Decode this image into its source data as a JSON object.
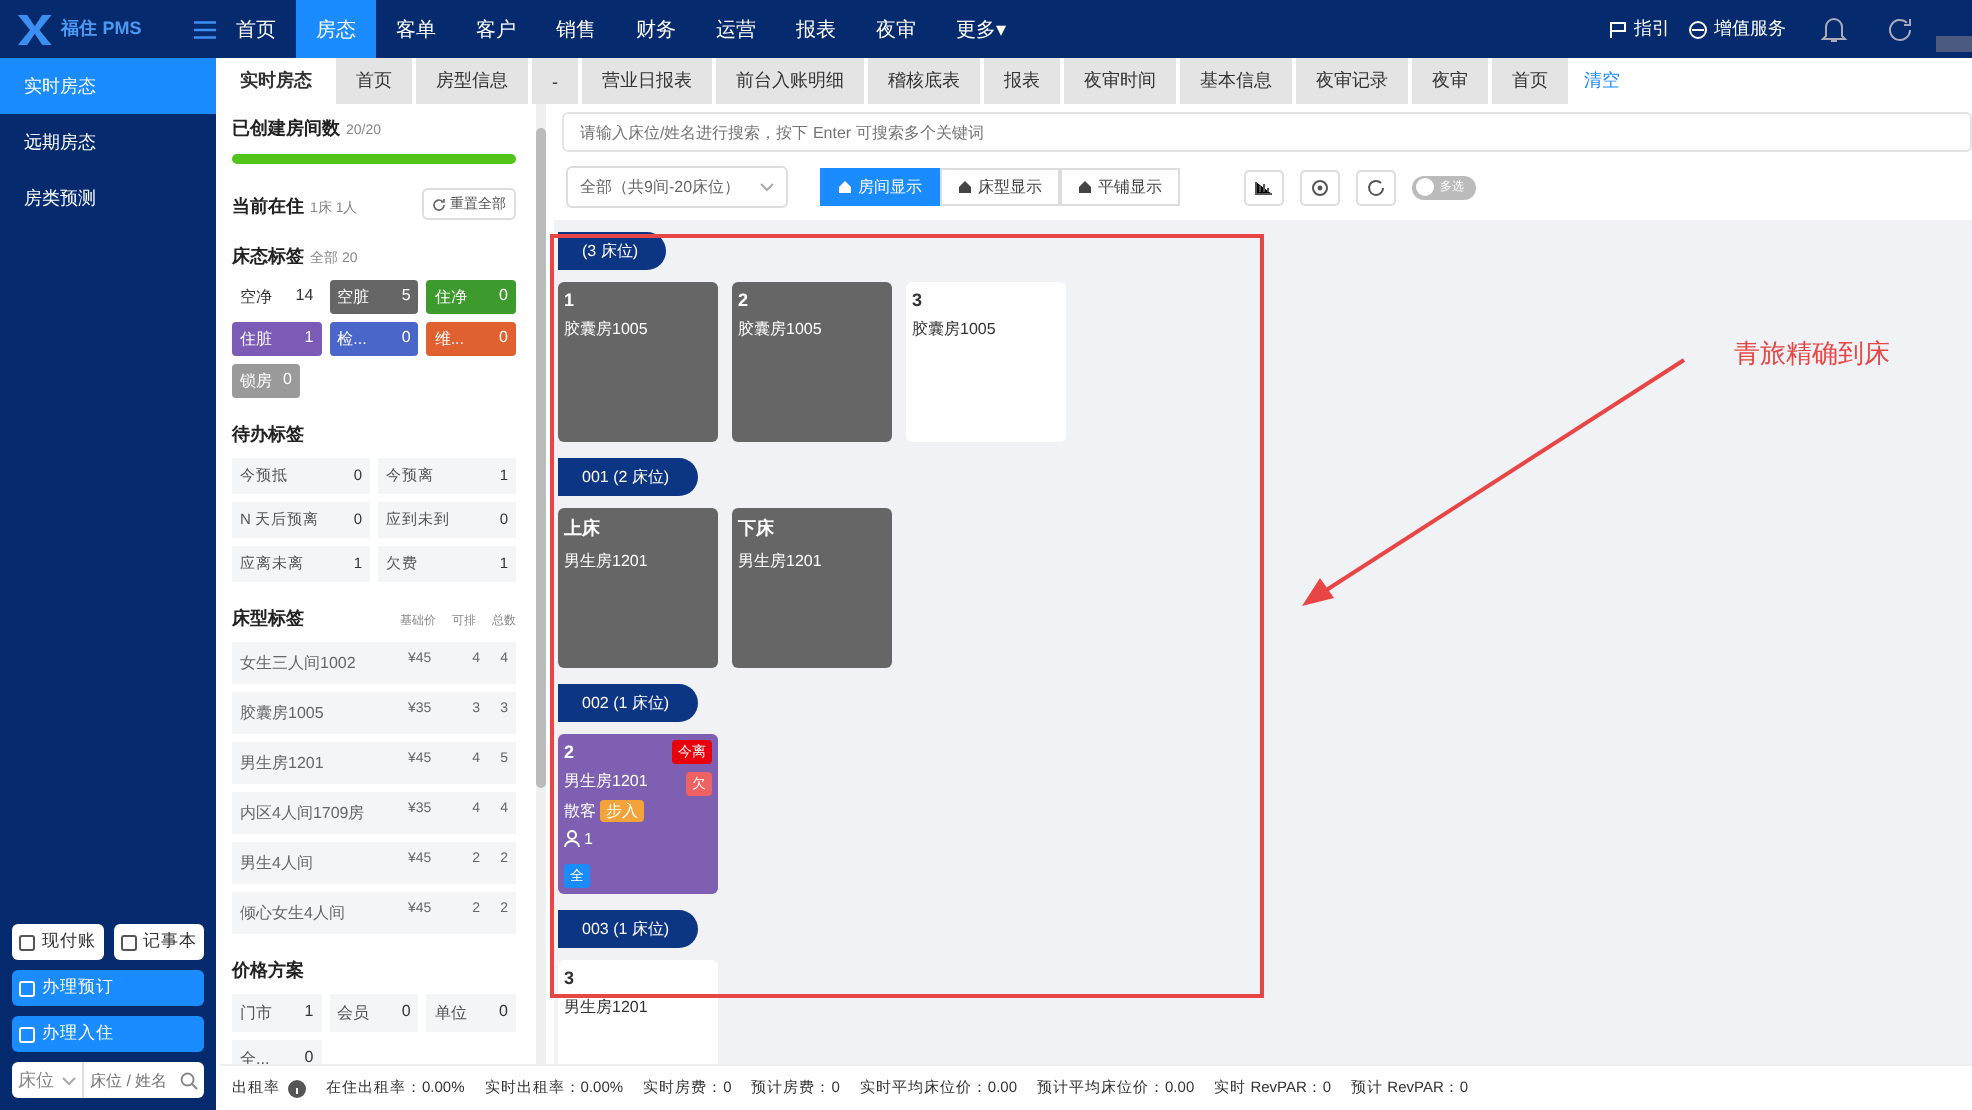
{
  "brand": "福住 PMS",
  "nav": [
    {
      "label": "首页",
      "selected": false
    },
    {
      "label": "房态",
      "selected": true
    },
    {
      "label": "客单",
      "selected": false
    },
    {
      "label": "客户",
      "selected": false
    },
    {
      "label": "销售",
      "selected": false
    },
    {
      "label": "财务",
      "selected": false
    },
    {
      "label": "运营",
      "selected": false
    },
    {
      "label": "报表",
      "selected": false
    },
    {
      "label": "夜审",
      "selected": false
    },
    {
      "label": "更多▾",
      "selected": false
    }
  ],
  "nav_right": {
    "guide": "指引",
    "services": "增值服务"
  },
  "sidebar": {
    "items": [
      {
        "label": "实时房态",
        "selected": true
      },
      {
        "label": "远期房态",
        "selected": false
      },
      {
        "label": "房类预测",
        "selected": false
      }
    ],
    "buttons": [
      {
        "label": "现付账",
        "kind": "outline"
      },
      {
        "label": "记事本",
        "kind": "outline"
      },
      {
        "label": "办理预订",
        "kind": "primary"
      },
      {
        "label": "办理入住",
        "kind": "primary"
      }
    ],
    "search": {
      "select": "床位",
      "placeholder": "床位 / 姓名"
    }
  },
  "tabs": [
    {
      "label": "实时房态",
      "selected": true
    },
    {
      "label": "首页",
      "selected": false
    },
    {
      "label": "房型信息",
      "selected": false
    },
    {
      "label": "-",
      "selected": false
    },
    {
      "label": "营业日报表",
      "selected": false
    },
    {
      "label": "前台入账明细",
      "selected": false
    },
    {
      "label": "稽核底表",
      "selected": false
    },
    {
      "label": "报表",
      "selected": false
    },
    {
      "label": "夜审时间",
      "selected": false
    },
    {
      "label": "基本信息",
      "selected": false
    },
    {
      "label": "夜审记录",
      "selected": false
    },
    {
      "label": "夜审",
      "selected": false
    },
    {
      "label": "首页",
      "selected": false
    }
  ],
  "tabs_clear": "清空",
  "panel": {
    "created": {
      "title": "已创建房间数",
      "count": "20/20",
      "level": 1
    },
    "current": {
      "title": "当前在住",
      "count": "1床 1人",
      "reset": "重置全部"
    },
    "status_tags": {
      "title": "床态标签",
      "all": "全部 20",
      "items": [
        {
          "label": "空净",
          "count": "14",
          "color": "#ffffff"
        },
        {
          "label": "空脏",
          "count": "5",
          "color": "#666666"
        },
        {
          "label": "住净",
          "count": "0",
          "color": "#3d9a2c"
        },
        {
          "label": "住脏",
          "count": "1",
          "color": "#7c5bb6"
        },
        {
          "label": "检...",
          "count": "0",
          "color": "#4a66c8"
        },
        {
          "label": "维...",
          "count": "0",
          "color": "#e0602f"
        },
        {
          "label": "锁房",
          "count": "0",
          "color": "#9a9a9a"
        }
      ]
    },
    "todo": {
      "title": "待办标签",
      "items": [
        {
          "label": "今预抵",
          "count": "0"
        },
        {
          "label": "今预离",
          "count": "1"
        },
        {
          "label": "N 天后预离",
          "count": "0"
        },
        {
          "label": "应到未到",
          "count": "0"
        },
        {
          "label": "应离未离",
          "count": "1"
        },
        {
          "label": "欠费",
          "count": "1"
        }
      ]
    },
    "bed_types": {
      "title": "床型标签",
      "columns": [
        "基础价",
        "可排",
        "总数"
      ],
      "rows": [
        {
          "name": "女生三人间1002",
          "price": "¥45",
          "available": "4",
          "total": "4"
        },
        {
          "name": "胶囊房1005",
          "price": "¥35",
          "available": "3",
          "total": "3"
        },
        {
          "name": "男生房1201",
          "price": "¥45",
          "available": "4",
          "total": "5"
        },
        {
          "name": "内区4人间1709房",
          "price": "¥35",
          "available": "4",
          "total": "4"
        },
        {
          "name": "男生4人间",
          "price": "¥45",
          "available": "2",
          "total": "2"
        },
        {
          "name": "倾心女生4人间",
          "price": "¥45",
          "available": "2",
          "total": "2"
        }
      ]
    },
    "price_plans": {
      "title": "价格方案",
      "items": [
        {
          "label": "门市",
          "count": "1"
        },
        {
          "label": "会员",
          "count": "0"
        },
        {
          "label": "单位",
          "count": "0"
        },
        {
          "label": "全...",
          "count": "0"
        }
      ]
    }
  },
  "search": {
    "placeholder": "请输入床位/姓名进行搜索，按下 Enter 可搜索多个关键词"
  },
  "filter": "全部（共9间-20床位）",
  "views": [
    {
      "label": "房间显示",
      "selected": true
    },
    {
      "label": "床型显示",
      "selected": false
    },
    {
      "label": "平铺显示",
      "selected": false
    }
  ],
  "multi_select": {
    "label": "多选",
    "on": false
  },
  "groups": [
    {
      "title": "(3 床位)",
      "beds": [
        {
          "name": "1",
          "room": "胶囊房1005",
          "color": "#666666"
        },
        {
          "name": "2",
          "room": "胶囊房1005",
          "color": "#666666"
        },
        {
          "name": "3",
          "room": "胶囊房1005",
          "color": "#ffffff"
        }
      ]
    },
    {
      "title": "001 (2 床位)",
      "beds": [
        {
          "name": "上床",
          "room": "男生房1201",
          "color": "#666666"
        },
        {
          "name": "下床",
          "room": "男生房1201",
          "color": "#666666"
        }
      ]
    },
    {
      "title": "002 (1 床位)",
      "beds": [
        {
          "name": "2",
          "room": "男生房1201",
          "color": "#7f5fb1",
          "departing": "今离",
          "owing": "欠",
          "guest_type": "散客",
          "source": "步入",
          "guests": "1",
          "badge": "全"
        }
      ]
    },
    {
      "title": "003 (1 床位)",
      "beds": [
        {
          "name": "3",
          "room": "男生房1201",
          "color": "#ffffff"
        }
      ]
    }
  ],
  "annotation": "青旅精确到床",
  "status_bar": {
    "title": "出租率",
    "items": [
      "在住出租率：0.00%",
      "实时出租率：0.00%",
      "实时房费：0",
      "预计房费：0",
      "实时平均床位价：0.00",
      "预计平均床位价：0.00",
      "实时 RevPAR：0",
      "预计 RevPAR：0"
    ]
  }
}
